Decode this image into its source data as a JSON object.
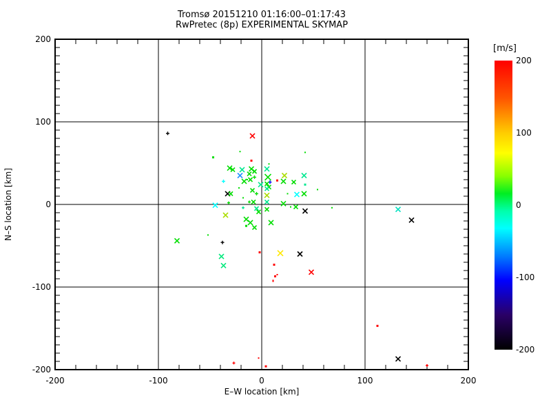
{
  "window": {
    "background": "#ffffff",
    "text_color": "#000000"
  },
  "chart_data": {
    "type": "scatter",
    "title_line1": "Tromsø 20151210 01:16:00–01:17:43",
    "title_line2": "RwPretec (8p) EXPERIMENTAL SKYMAP",
    "xlabel": "E–W location [km]",
    "ylabel": "N–S location [km]",
    "xlim": [
      -200,
      200
    ],
    "ylim": [
      -200,
      200
    ],
    "xticks": [
      -200,
      -100,
      0,
      100,
      200
    ],
    "yticks": [
      -200,
      -100,
      0,
      100,
      200
    ],
    "x_minor_step": 20,
    "y_minor_step": 10,
    "grid_lines_x": [
      -100,
      0,
      100
    ],
    "grid_lines_y": [
      -100,
      0,
      100
    ],
    "grid_on": true,
    "legend_position": "none",
    "colorbar": {
      "label": "[m/s]",
      "ticks": [
        200,
        100,
        0,
        -100,
        -200
      ],
      "min": -200,
      "max": 200,
      "stops": [
        {
          "pos": 0.0,
          "color": "#ff0000"
        },
        {
          "pos": 0.13,
          "color": "#ff5500"
        },
        {
          "pos": 0.25,
          "color": "#ffcc00"
        },
        {
          "pos": 0.32,
          "color": "#ffff00"
        },
        {
          "pos": 0.4,
          "color": "#88ff00"
        },
        {
          "pos": 0.46,
          "color": "#00ee22"
        },
        {
          "pos": 0.52,
          "color": "#00ffaa"
        },
        {
          "pos": 0.58,
          "color": "#00ffff"
        },
        {
          "pos": 0.68,
          "color": "#0077ff"
        },
        {
          "pos": 0.76,
          "color": "#0000ff"
        },
        {
          "pos": 0.88,
          "color": "#2a0066"
        },
        {
          "pos": 1.0,
          "color": "#000000"
        }
      ]
    },
    "points": [
      {
        "x": -91,
        "y": 86,
        "c": "#000000",
        "m": "p",
        "s": 5
      },
      {
        "x": -9,
        "y": 83,
        "c": "#ff0000",
        "m": "x",
        "s": 7
      },
      {
        "x": -47,
        "y": 57,
        "c": "#00dd00",
        "m": "d",
        "s": 3
      },
      {
        "x": -21,
        "y": 64,
        "c": "#00dd00",
        "m": "d",
        "s": 2
      },
      {
        "x": -10,
        "y": 53,
        "c": "#ff0000",
        "m": "d",
        "s": 3
      },
      {
        "x": 7,
        "y": 49,
        "c": "#00dd00",
        "m": "d",
        "s": 2
      },
      {
        "x": -31,
        "y": 44,
        "c": "#00dd00",
        "m": "x",
        "s": 7
      },
      {
        "x": -28,
        "y": 42,
        "c": "#00dd00",
        "m": "x",
        "s": 6
      },
      {
        "x": -19,
        "y": 42,
        "c": "#00e890",
        "m": "x",
        "s": 7
      },
      {
        "x": -10,
        "y": 43,
        "c": "#00dd00",
        "m": "x",
        "s": 7
      },
      {
        "x": -21,
        "y": 35,
        "c": "#1e90ff",
        "m": "x",
        "s": 7
      },
      {
        "x": -12,
        "y": 37,
        "c": "#00dd00",
        "m": "x",
        "s": 6
      },
      {
        "x": -7,
        "y": 40,
        "c": "#00dd00",
        "m": "x",
        "s": 6
      },
      {
        "x": -11,
        "y": 30,
        "c": "#00dd00",
        "m": "x",
        "s": 6
      },
      {
        "x": -7,
        "y": 33,
        "c": "#00dd00",
        "m": "p",
        "s": 5
      },
      {
        "x": 5,
        "y": 43,
        "c": "#00e890",
        "m": "x",
        "s": 7
      },
      {
        "x": 6,
        "y": 33,
        "c": "#00dd00",
        "m": "x",
        "s": 9
      },
      {
        "x": 8,
        "y": 27,
        "c": "#0000ff",
        "m": "p",
        "s": 5
      },
      {
        "x": 15,
        "y": 29,
        "c": "#ff0000",
        "m": "d",
        "s": 3
      },
      {
        "x": -37,
        "y": 28,
        "c": "#00ffff",
        "m": "p",
        "s": 5
      },
      {
        "x": -17,
        "y": 28,
        "c": "#00dd00",
        "m": "x",
        "s": 7
      },
      {
        "x": -14,
        "y": 30,
        "c": "#00dd00",
        "m": "d",
        "s": 2
      },
      {
        "x": -1,
        "y": 24,
        "c": "#00e890",
        "m": "x",
        "s": 7
      },
      {
        "x": 5,
        "y": 25,
        "c": "#00dd00",
        "m": "x",
        "s": 6
      },
      {
        "x": 7,
        "y": 21,
        "c": "#00dd00",
        "m": "x",
        "s": 6
      },
      {
        "x": -33,
        "y": 13,
        "c": "#000000",
        "m": "x",
        "s": 7
      },
      {
        "x": -30,
        "y": 13,
        "c": "#00dd00",
        "m": "x",
        "s": 6
      },
      {
        "x": -22,
        "y": 20,
        "c": "#00dd00",
        "m": "d",
        "s": 2
      },
      {
        "x": -9,
        "y": 17,
        "c": "#00dd00",
        "m": "x",
        "s": 6
      },
      {
        "x": -5,
        "y": 13,
        "c": "#00dd00",
        "m": "p",
        "s": 5
      },
      {
        "x": 5,
        "y": 11,
        "c": "#aadd00",
        "m": "x",
        "s": 7
      },
      {
        "x": 5,
        "y": 19,
        "c": "#00e890",
        "m": "x",
        "s": 6
      },
      {
        "x": -18,
        "y": 8,
        "c": "#00dd00",
        "m": "d",
        "s": 2
      },
      {
        "x": 42,
        "y": 63,
        "c": "#00dd00",
        "m": "d",
        "s": 2
      },
      {
        "x": 22,
        "y": 35,
        "c": "#aadd00",
        "m": "x",
        "s": 7
      },
      {
        "x": 21,
        "y": 28,
        "c": "#00dd00",
        "m": "x",
        "s": 7
      },
      {
        "x": 31,
        "y": 27,
        "c": "#00dd00",
        "m": "x",
        "s": 6
      },
      {
        "x": 41,
        "y": 35,
        "c": "#00e890",
        "m": "x",
        "s": 7
      },
      {
        "x": 42,
        "y": 24,
        "c": "#00e890",
        "m": "d",
        "s": 3
      },
      {
        "x": 54,
        "y": 18,
        "c": "#00dd00",
        "m": "d",
        "s": 2
      },
      {
        "x": 34,
        "y": 12,
        "c": "#00ffff",
        "m": "x",
        "s": 7
      },
      {
        "x": 41,
        "y": 13,
        "c": "#00dd00",
        "m": "x",
        "s": 7
      },
      {
        "x": 25,
        "y": 13,
        "c": "#00dd00",
        "m": "d",
        "s": 2
      },
      {
        "x": -45,
        "y": -1,
        "c": "#00ffff",
        "m": "x",
        "s": 7
      },
      {
        "x": -32,
        "y": 2,
        "c": "#00dd00",
        "m": "p",
        "s": 4
      },
      {
        "x": -18,
        "y": -4,
        "c": "#00e890",
        "m": "p",
        "s": 4
      },
      {
        "x": -35,
        "y": -13,
        "c": "#aadd00",
        "m": "x",
        "s": 7
      },
      {
        "x": -15,
        "y": -18,
        "c": "#00dd00",
        "m": "x",
        "s": 7
      },
      {
        "x": -11,
        "y": -22,
        "c": "#00dd00",
        "m": "x",
        "s": 7
      },
      {
        "x": -15,
        "y": -26,
        "c": "#00dd00",
        "m": "d",
        "s": 3
      },
      {
        "x": -7,
        "y": -28,
        "c": "#00dd00",
        "m": "x",
        "s": 6
      },
      {
        "x": -12,
        "y": 3,
        "c": "#00dd00",
        "m": "p",
        "s": 4
      },
      {
        "x": -8,
        "y": 3,
        "c": "#00dd00",
        "m": "x",
        "s": 6
      },
      {
        "x": -5,
        "y": -5,
        "c": "#00e890",
        "m": "x",
        "s": 6
      },
      {
        "x": -3,
        "y": -9,
        "c": "#00dd00",
        "m": "x",
        "s": 6
      },
      {
        "x": 5,
        "y": 3,
        "c": "#00e890",
        "m": "x",
        "s": 6
      },
      {
        "x": 5,
        "y": -6,
        "c": "#00dd00",
        "m": "x",
        "s": 6
      },
      {
        "x": 9,
        "y": -22,
        "c": "#00dd00",
        "m": "x",
        "s": 7
      },
      {
        "x": -52,
        "y": -37,
        "c": "#00dd00",
        "m": "d",
        "s": 2
      },
      {
        "x": 21,
        "y": 1,
        "c": "#00dd00",
        "m": "x",
        "s": 7
      },
      {
        "x": 28,
        "y": -3,
        "c": "#00dd00",
        "m": "d",
        "s": 2
      },
      {
        "x": 33,
        "y": -3,
        "c": "#00dd00",
        "m": "x",
        "s": 6
      },
      {
        "x": 42,
        "y": -8,
        "c": "#000000",
        "m": "x",
        "s": 7
      },
      {
        "x": 68,
        "y": -4,
        "c": "#00dd00",
        "m": "d",
        "s": 2
      },
      {
        "x": -38,
        "y": -46,
        "c": "#000000",
        "m": "p",
        "s": 5
      },
      {
        "x": -39,
        "y": -63,
        "c": "#00e87c",
        "m": "x",
        "s": 7
      },
      {
        "x": -37,
        "y": -74,
        "c": "#00e87c",
        "m": "x",
        "s": 7
      },
      {
        "x": -82,
        "y": -44,
        "c": "#00dd00",
        "m": "x",
        "s": 7
      },
      {
        "x": -2,
        "y": -58,
        "c": "#ff0000",
        "m": "d",
        "s": 3
      },
      {
        "x": 18,
        "y": -59,
        "c": "#ffe800",
        "m": "x",
        "s": 8
      },
      {
        "x": 37,
        "y": -60,
        "c": "#000000",
        "m": "x",
        "s": 7
      },
      {
        "x": 12,
        "y": -73,
        "c": "#ff0000",
        "m": "d",
        "s": 3
      },
      {
        "x": 48,
        "y": -82,
        "c": "#ff0000",
        "m": "x",
        "s": 7
      },
      {
        "x": 13,
        "y": -87,
        "c": "#ff0000",
        "m": "d",
        "s": 3
      },
      {
        "x": 15,
        "y": -85,
        "c": "#ff0000",
        "m": "d",
        "s": 2
      },
      {
        "x": 11,
        "y": -92,
        "c": "#ff0000",
        "m": "d",
        "s": 2
      },
      {
        "x": 11,
        "y": -93,
        "c": "#ff0000",
        "m": "d",
        "s": 2
      },
      {
        "x": 132,
        "y": -6,
        "c": "#00e0c0",
        "m": "x",
        "s": 7
      },
      {
        "x": 145,
        "y": -19,
        "c": "#000000",
        "m": "x",
        "s": 7
      },
      {
        "x": 112,
        "y": -147,
        "c": "#ff0000",
        "m": "d",
        "s": 3
      },
      {
        "x": -27,
        "y": -192,
        "c": "#ff0000",
        "m": "p",
        "s": 4
      },
      {
        "x": -3,
        "y": -186,
        "c": "#ff0000",
        "m": "d",
        "s": 2
      },
      {
        "x": 4,
        "y": -196,
        "c": "#ff0000",
        "m": "d",
        "s": 3
      },
      {
        "x": 132,
        "y": -187,
        "c": "#000000",
        "m": "x",
        "s": 7
      },
      {
        "x": 160,
        "y": -195,
        "c": "#ff0000",
        "m": "p",
        "s": 4
      }
    ]
  }
}
